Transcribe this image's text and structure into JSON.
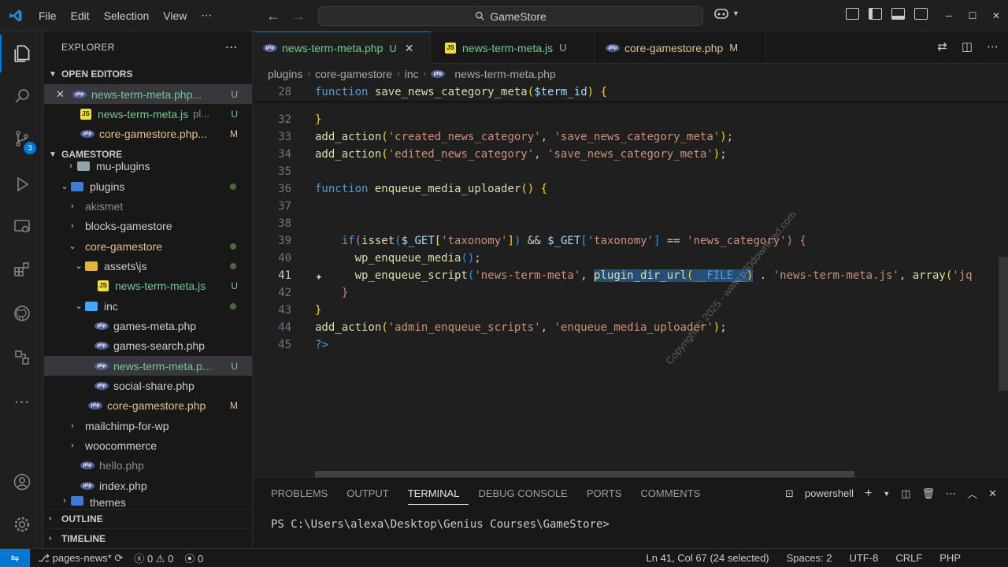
{
  "menu": [
    "File",
    "Edit",
    "Selection",
    "View"
  ],
  "search": {
    "label": "GameStore"
  },
  "sidebar": {
    "explorer_title": "EXPLORER",
    "open_editors_title": "OPEN EDITORS",
    "open_editors": [
      {
        "name": "news-term-meta.php...",
        "status": "U"
      },
      {
        "name": "news-term-meta.js",
        "path": "pl...",
        "status": "U"
      },
      {
        "name": "core-gamestore.php...",
        "status": "M"
      }
    ],
    "workspace_title": "GAMESTORE",
    "tree": {
      "mu_plugins": "mu-plugins",
      "plugins": "plugins",
      "akismet": "akismet",
      "blocks_gamestore": "blocks-gamestore",
      "core_gamestore": "core-gamestore",
      "assets_js": "assets\\js",
      "news_term_meta_js": "news-term-meta.js",
      "news_term_meta_js_status": "U",
      "inc": "inc",
      "games_meta": "games-meta.php",
      "games_search": "games-search.php",
      "news_term_meta_php": "news-term-meta.p...",
      "news_term_meta_php_status": "U",
      "social_share": "social-share.php",
      "core_gamestore_php": "core-gamestore.php",
      "core_gamestore_php_status": "M",
      "mailchimp": "mailchimp-for-wp",
      "woocommerce": "woocommerce",
      "hello": "hello.php",
      "index": "index.php",
      "themes": "themes"
    },
    "outline_title": "OUTLINE",
    "timeline_title": "TIMELINE"
  },
  "activity": {
    "scm_badge": "3"
  },
  "tabs": [
    {
      "name": "news-term-meta.php",
      "status": "U"
    },
    {
      "name": "news-term-meta.js",
      "status": "U"
    },
    {
      "name": "core-gamestore.php",
      "status": "M"
    }
  ],
  "breadcrumb": [
    "plugins",
    "core-gamestore",
    "inc",
    "news-term-meta.php"
  ],
  "editor": {
    "sticky": {
      "ln": "28",
      "text": "function save_news_category_meta($term_id) {"
    },
    "lines": {
      "l32": "32",
      "l33": "33",
      "l34": "34",
      "l35": "35",
      "l36": "36",
      "l37": "37",
      "l38": "38",
      "l39": "39",
      "l40": "40",
      "l41": "41",
      "l42": "42",
      "l43": "43",
      "l44": "44",
      "l45": "45"
    },
    "watermark": "Copyright © 2025 - www.p30download.com"
  },
  "panel": {
    "tabs": [
      "PROBLEMS",
      "OUTPUT",
      "TERMINAL",
      "DEBUG CONSOLE",
      "PORTS",
      "COMMENTS"
    ],
    "shell": "powershell",
    "prompt": "PS C:\\Users\\alexa\\Desktop\\Genius Courses\\GameStore>"
  },
  "statusbar": {
    "branch": "pages-news*",
    "errors": "0",
    "warnings": "0",
    "ports": "0",
    "position": "Ln 41, Col 67 (24 selected)",
    "spaces": "Spaces: 2",
    "encoding": "UTF-8",
    "eol": "CRLF",
    "language": "PHP"
  },
  "colors": {
    "accent": "#0078d4",
    "untracked": "#73c991",
    "modified": "#e2c08d"
  }
}
